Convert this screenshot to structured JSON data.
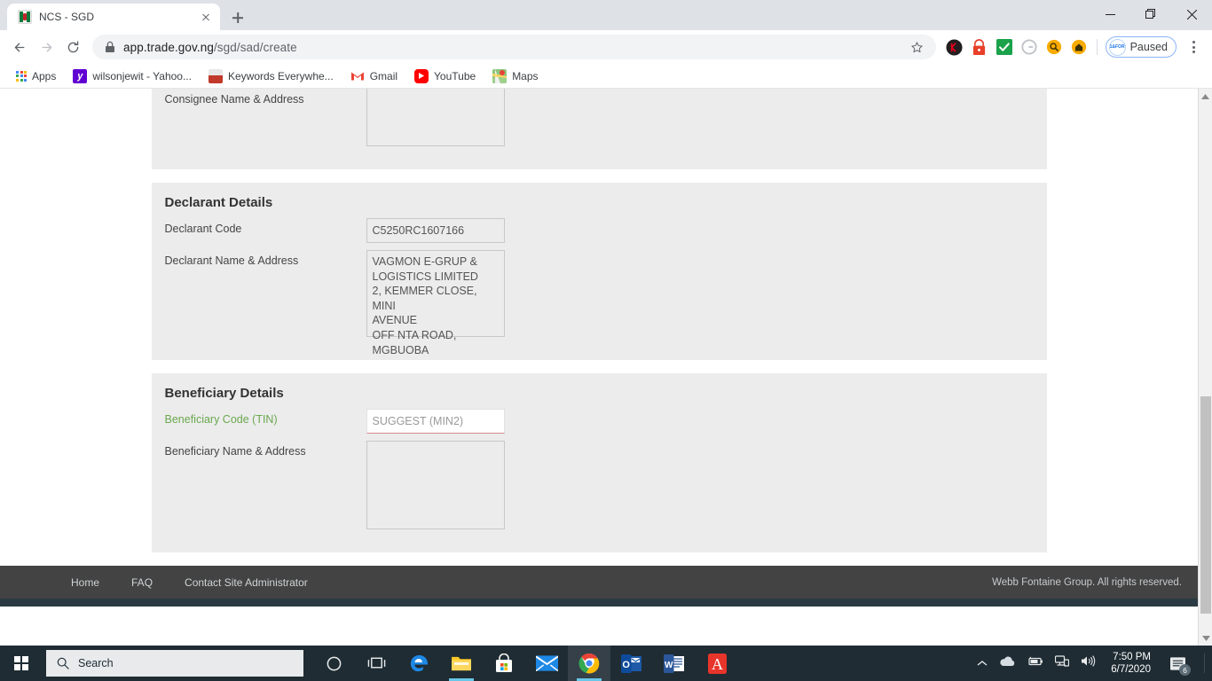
{
  "browser": {
    "tab": {
      "title": "NCS - SGD",
      "favicon": "nigeria-coat-of-arms-favicon",
      "close_icon": "close-icon"
    },
    "new_tab_icon": "plus-icon",
    "window_controls": {
      "minimize": "minimize-icon",
      "maximize": "maximize-icon",
      "close": "close-icon"
    },
    "nav": {
      "back": "back-arrow-icon",
      "forward": "forward-arrow-icon",
      "reload": "reload-icon"
    },
    "omnibox": {
      "lock_icon": "lock-icon",
      "url_host": "app.trade.gov.ng",
      "url_path": "/sgd/sad/create",
      "star_icon": "bookmark-star-icon"
    },
    "extensions": [
      {
        "name": "kaspersky-extension-icon",
        "color": "#231f20"
      },
      {
        "name": "lastpass-extension-icon",
        "color": "#e8402a"
      },
      {
        "name": "checkmark-extension-icon",
        "color": "#1aa24a"
      },
      {
        "name": "grammarly-extension-icon",
        "color": "#9aa0a6"
      },
      {
        "name": "search-extension-icon",
        "color": "#f9ab00"
      },
      {
        "name": "home-extension-icon",
        "color": "#f9ab00"
      }
    ],
    "paused": {
      "label": "Paused",
      "badge_text": "1&FOR",
      "badge_icon": "profile-paused-icon"
    },
    "menu_icon": "three-dot-menu-icon",
    "bookmarks": [
      {
        "label": "Apps",
        "icon": "apps-grid-icon"
      },
      {
        "label": "wilsonjewit - Yahoo...",
        "icon": "yahoo-icon"
      },
      {
        "label": "Keywords Everywhe...",
        "icon": "keywords-everywhere-icon"
      },
      {
        "label": "Gmail",
        "icon": "gmail-icon"
      },
      {
        "label": "YouTube",
        "icon": "youtube-icon"
      },
      {
        "label": "Maps",
        "icon": "google-maps-icon"
      }
    ]
  },
  "form": {
    "consignee": {
      "fields": [
        {
          "label": "Consignee Name & Address",
          "value": "",
          "type": "textarea"
        }
      ]
    },
    "declarant": {
      "title": "Declarant Details",
      "fields": [
        {
          "label": "Declarant Code",
          "value": "C5250RC1607166",
          "type": "input"
        },
        {
          "label": "Declarant Name & Address",
          "value": "VAGMON E-GRUP &\nLOGISTICS LIMITED\n2, KEMMER CLOSE, MINI\nAVENUE\nOFF NTA ROAD, MGBUOBA",
          "type": "textarea"
        }
      ]
    },
    "beneficiary": {
      "title": "Beneficiary Details",
      "fields": [
        {
          "label": "Beneficiary Code (TIN)",
          "value": "",
          "placeholder": "SUGGEST (MIN2)",
          "type": "input",
          "label_color": "#6aa84f",
          "state": "error"
        },
        {
          "label": "Beneficiary Name & Address",
          "value": "",
          "type": "textarea"
        }
      ]
    }
  },
  "site_footer": {
    "links": [
      "Home",
      "FAQ",
      "Contact Site Administrator"
    ],
    "copyright": "Webb Fontaine Group. All rights reserved."
  },
  "scrollbar": {
    "up_icon": "scroll-up-arrow-icon",
    "down_icon": "scroll-down-arrow-icon"
  },
  "taskbar": {
    "start_icon": "windows-start-icon",
    "search_placeholder": "Search",
    "search_icon": "search-icon",
    "items": [
      {
        "name": "cortana-icon"
      },
      {
        "name": "task-view-icon"
      },
      {
        "name": "microsoft-edge-icon"
      },
      {
        "name": "file-explorer-icon"
      },
      {
        "name": "microsoft-store-icon"
      },
      {
        "name": "mail-icon"
      },
      {
        "name": "google-chrome-icon"
      },
      {
        "name": "microsoft-outlook-icon"
      },
      {
        "name": "microsoft-word-icon"
      },
      {
        "name": "adobe-acrobat-icon"
      }
    ],
    "tray": {
      "chevron_icon": "show-hidden-icons-chevron",
      "onedrive_icon": "onedrive-icon",
      "battery_icon": "battery-charging-icon",
      "network_icon": "network-icon",
      "volume_icon": "volume-icon",
      "time": "7:50 PM",
      "date": "6/7/2020",
      "notification_icon": "action-center-icon",
      "notification_count": "6"
    }
  }
}
